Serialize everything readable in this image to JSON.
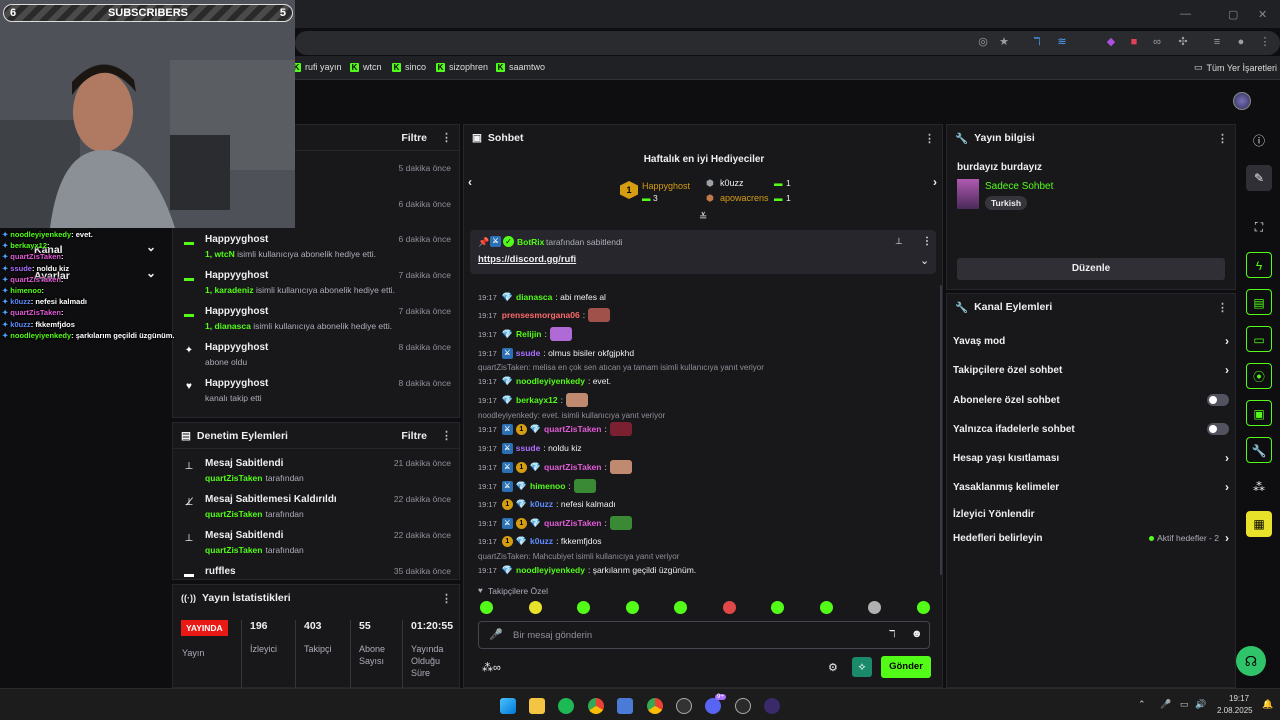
{
  "overlay": {
    "subs_left": "6",
    "subs_label": "SUBSCRIBERS",
    "subs_right": "5",
    "chat": [
      {
        "user": "noodleyiyenkedy",
        "text": ": evet."
      },
      {
        "user": "berkayx12",
        "text": ":"
      },
      {
        "user": "quartZisTaken",
        "text": ":"
      },
      {
        "user": "ssude",
        "text": ": noldu kiz"
      },
      {
        "user": "quartZisTaken",
        "text": ":"
      },
      {
        "user": "himenoo",
        "text": ":"
      },
      {
        "user": "k0uzz",
        "text": ": nefesi kalmadı"
      },
      {
        "user": "quartZisTaken",
        "text": ":"
      },
      {
        "user": "k0uzz",
        "text": ": fkkemfjdos"
      },
      {
        "user": "noodleyiyenkedy",
        "text": ": şarkılarım geçildi üzgünüm."
      }
    ]
  },
  "browser": {
    "bookmarks": [
      "rufi yayın",
      "wtcn",
      "sinco",
      "sizophren",
      "saamtwo"
    ],
    "all_bookmarks": "Tüm Yer İşaretleri"
  },
  "leftnav": {
    "kanal": "Kanal",
    "ayarlar": "Ayarlar"
  },
  "activity": {
    "filter": "Filtre",
    "partial_times": [
      "5 dakika önce",
      "6 dakika önce"
    ],
    "items": [
      {
        "name": "Happyyghost",
        "desc_bold": "1, wtcN",
        "desc": " isimli kullanıcıya abonelik hediye etti.",
        "time": "6 dakika önce",
        "icon": "gift-icon"
      },
      {
        "name": "Happyyghost",
        "desc_bold": "1, karadeniz",
        "desc": " isimli kullanıcıya abonelik hediye etti.",
        "time": "7 dakika önce",
        "icon": "gift-icon"
      },
      {
        "name": "Happyyghost",
        "desc_bold": "1, dianasca",
        "desc": " isimli kullanıcıya abonelik hediye etti.",
        "time": "7 dakika önce",
        "icon": "gift-icon"
      },
      {
        "name": "Happyyghost",
        "desc_bold": "",
        "desc": "abone oldu",
        "time": "8 dakika önce",
        "icon": "star-icon"
      },
      {
        "name": "Happyyghost",
        "desc_bold": "",
        "desc": "kanalı takip etti",
        "time": "8 dakika önce",
        "icon": "heart-icon"
      }
    ]
  },
  "moderation": {
    "title": "Denetim Eylemleri",
    "filter": "Filtre",
    "items": [
      {
        "action": "Mesaj Sabitlendi",
        "user": "quartZisTaken",
        "suffix": "tarafından",
        "time": "21 dakika önce",
        "icon": "pin-icon"
      },
      {
        "action": "Mesaj Sabitlemesi Kaldırıldı",
        "user": "quartZisTaken",
        "suffix": "tarafından",
        "time": "22 dakika önce",
        "icon": "unpin-icon"
      },
      {
        "action": "Mesaj Sabitlendi",
        "user": "quartZisTaken",
        "suffix": "tarafından",
        "time": "22 dakika önce",
        "icon": "pin-icon"
      },
      {
        "action": "ruffles",
        "user": "",
        "suffix": "",
        "time": "35 dakika önce",
        "icon": "list-icon"
      }
    ]
  },
  "stats": {
    "title": "Yayın İstatistikleri",
    "live": "YAYINDA",
    "live_label": "Yayın",
    "items": [
      {
        "value": "196",
        "label": "İzleyici"
      },
      {
        "value": "403",
        "label": "Takipçi"
      },
      {
        "value": "55",
        "label": "Abone Sayısı"
      },
      {
        "value": "01:20:55",
        "label": "Yayında Olduğu Süre"
      }
    ]
  },
  "chat": {
    "title": "Sohbet",
    "gifters_title": "Haftalık en iyi Hediyeciler",
    "gifters": [
      {
        "rank": "1",
        "name": "Happyghost",
        "count": "3"
      },
      {
        "rank": "",
        "name": "k0uzz",
        "count": "1"
      },
      {
        "rank": "",
        "name": "apowacrens",
        "count": "1"
      }
    ],
    "pinned_by": "BotRix",
    "pinned_suffix": "tarafından sabitlendi",
    "pinned_link": "https://discord.gg/rufi",
    "messages": [
      {
        "time": "19:17",
        "user": "dianasca",
        "color": "#53fc18",
        "text": ": abi mefes al",
        "badges": [
          "gem"
        ],
        "emote": ""
      },
      {
        "time": "19:17",
        "user": "prensesmorgana06",
        "color": "#ff6b6b",
        "text": ":",
        "badges": [],
        "emote": "#a0524a"
      },
      {
        "time": "19:17",
        "user": "Relijin",
        "color": "#53fc18",
        "text": ":",
        "badges": [
          "gem"
        ],
        "emote": "#b06ad6"
      },
      {
        "time": "19:17",
        "user": "ssude",
        "color": "#a970ff",
        "text": ": olmus bisiler okfgjpkhd",
        "badges": [
          "mod"
        ],
        "emote": ""
      },
      {
        "time": "19:17",
        "user": "noodleyiyenkedy",
        "color": "#53fc18",
        "text": ": evet.",
        "badges": [
          "gem"
        ],
        "emote": ""
      },
      {
        "time": "19:17",
        "user": "berkayx12",
        "color": "#53fc18",
        "text": ":",
        "badges": [
          "gem"
        ],
        "emote": "#c08a70"
      },
      {
        "time": "19:17",
        "user": "quartZisTaken",
        "color": "#e25bd6",
        "text": ":",
        "badges": [
          "mod",
          "sub",
          "gem"
        ],
        "emote": "#7a2030"
      },
      {
        "time": "19:17",
        "user": "ssude",
        "color": "#a970ff",
        "text": ": noldu kiz",
        "badges": [
          "mod"
        ],
        "emote": ""
      },
      {
        "time": "19:17",
        "user": "quartZisTaken",
        "color": "#e25bd6",
        "text": ":",
        "badges": [
          "mod",
          "sub",
          "gem"
        ],
        "emote": "#c08a70"
      },
      {
        "time": "19:17",
        "user": "himenoo",
        "color": "#53fc18",
        "text": ":",
        "badges": [
          "mod",
          "gem"
        ],
        "emote": "#3a8a35"
      },
      {
        "time": "19:17",
        "user": "k0uzz",
        "color": "#5d8cff",
        "text": ": nefesi kalmadı",
        "badges": [
          "sub",
          "gem"
        ],
        "emote": ""
      },
      {
        "time": "19:17",
        "user": "quartZisTaken",
        "color": "#e25bd6",
        "text": ":",
        "badges": [
          "mod",
          "sub",
          "gem"
        ],
        "emote": "#3a8a35"
      },
      {
        "time": "19:17",
        "user": "k0uzz",
        "color": "#5d8cff",
        "text": ": fkkemfjdos",
        "badges": [
          "sub",
          "gem"
        ],
        "emote": ""
      },
      {
        "time": "19:17",
        "user": "noodleyiyenkedy",
        "color": "#53fc18",
        "text": ": şarkılarım geçildi üzgünüm.",
        "badges": [
          "gem"
        ],
        "emote": ""
      }
    ],
    "replies": [
      "quartZisTaken: melisa en çok sen atıcan ya tamam isimli kullanıcıya yanıt veriyor",
      "noodleyiyenkedy: evet. isimli kullanıcıya yanıt veriyor",
      "quartZisTaken: Mahcubiyet isimli kullanıcıya yanıt veriyor"
    ],
    "followers_only": "Takipçilere Özel",
    "input_placeholder": "Bir mesaj gönderin",
    "send": "Gönder"
  },
  "stream_info": {
    "title": "Yayın bilgisi",
    "stream_title": "burdayız burdayız",
    "category": "Sadece Sohbet",
    "tag": "Turkish",
    "edit": "Düzenle"
  },
  "channel_actions": {
    "title": "Kanal Eylemleri",
    "items": [
      {
        "label": "Yavaş mod",
        "control": "chevron"
      },
      {
        "label": "Takipçilere özel sohbet",
        "control": "chevron"
      },
      {
        "label": "Abonelere özel sohbet",
        "control": "toggle"
      },
      {
        "label": "Yalnızca ifadelerle sohbet",
        "control": "toggle"
      },
      {
        "label": "Hesap yaşı kısıtlaması",
        "control": "chevron"
      },
      {
        "label": "Yasaklanmış kelimeler",
        "control": "chevron"
      },
      {
        "label": "İzleyici Yönlendir",
        "control": "none"
      },
      {
        "label": "Hedefleri belirleyin",
        "control": "chevron"
      }
    ],
    "goals_status": "Aktif hedefler - 2"
  },
  "taskbar": {
    "time": "19:17",
    "date": "2.08.2025",
    "discord_badge": "9+"
  },
  "colors": {
    "accent": "#53fc18",
    "bg": "#0e0e10",
    "panel": "#18181b",
    "live": "#e91916"
  }
}
